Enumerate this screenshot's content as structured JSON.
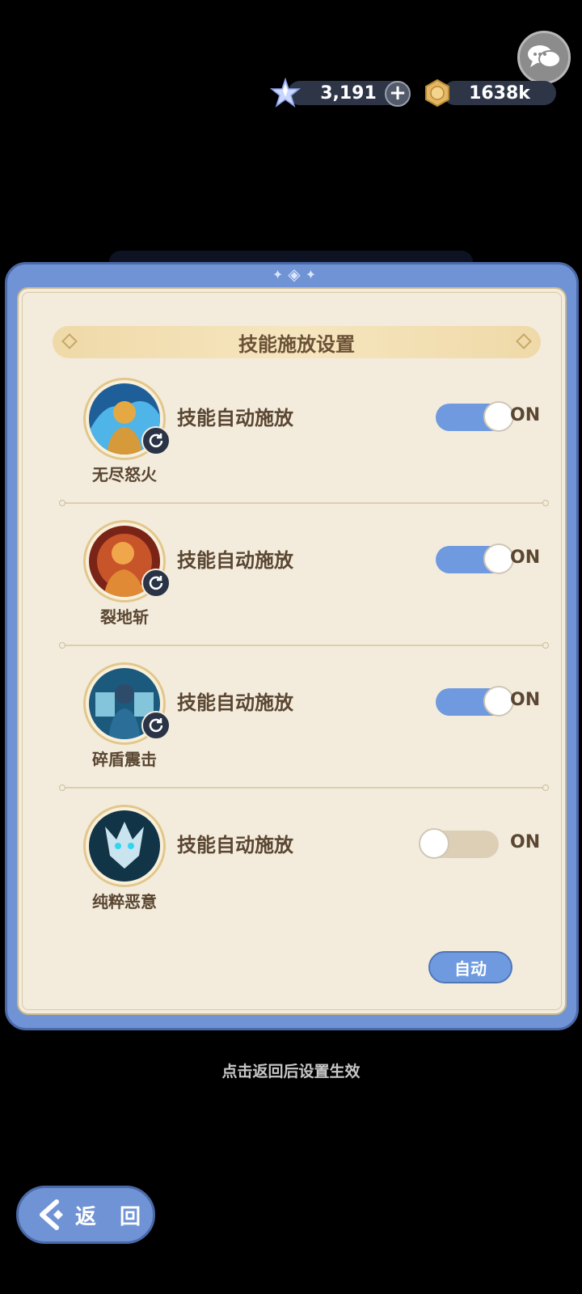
{
  "currency": {
    "gems": "3,191",
    "gold": "1638k"
  },
  "dialog": {
    "title": "技能施放设置",
    "rows": [
      {
        "skill": "无尽怒火",
        "label": "技能自动施放",
        "state": "ON",
        "enabled": true,
        "has_refresh": true
      },
      {
        "skill": "裂地斩",
        "label": "技能自动施放",
        "state": "ON",
        "enabled": true,
        "has_refresh": true
      },
      {
        "skill": "碎盾震击",
        "label": "技能自动施放",
        "state": "ON",
        "enabled": true,
        "has_refresh": true
      },
      {
        "skill": "纯粹恶意",
        "label": "技能自动施放",
        "state": "ON",
        "enabled": false,
        "has_refresh": false
      }
    ],
    "auto_button": "自动"
  },
  "hint": "点击返回后设置生效",
  "back_button": "返 回",
  "colors": {
    "accent": "#6f9ae0",
    "panel": "#f3ecdd",
    "text": "#5a4631"
  },
  "icons": [
    "chat-icon",
    "gem-icon",
    "plus-icon",
    "coin-icon",
    "refresh-icon",
    "back-arrow-icon"
  ]
}
